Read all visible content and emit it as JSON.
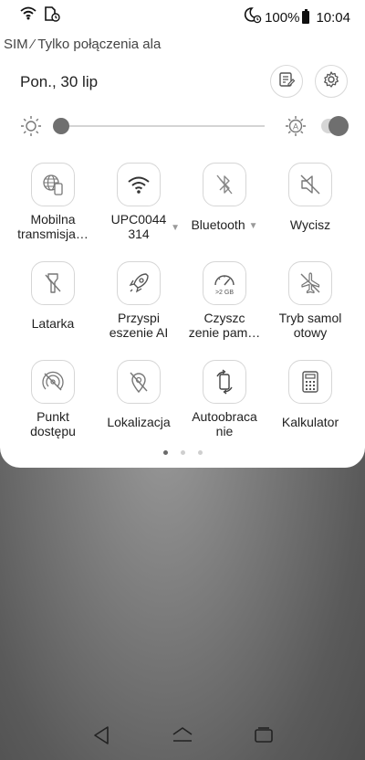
{
  "status_bar": {
    "battery": "100%",
    "time": "10:04",
    "icons": [
      "wifi-icon",
      "sim-alarm-icon",
      "moon-alarm-icon",
      "battery-icon"
    ]
  },
  "carrier_text": "SIM ⁄ Tylko połączenia ala",
  "date": "Pon., 30 lip",
  "header_buttons": [
    "edit-icon",
    "settings-gear-icon"
  ],
  "brightness": {
    "level": 0.0,
    "auto": true
  },
  "tiles": [
    {
      "line1": "Mobilna",
      "line2": "transmisja…",
      "icon": "globe-phone-icon"
    },
    {
      "line1": "UPC0044",
      "line2": "314",
      "icon": "wifi-icon",
      "dropdown": true
    },
    {
      "line1": "Bluetooth",
      "icon": "bluetooth-off-icon",
      "dropdown": true
    },
    {
      "line1": "Wycisz",
      "icon": "mute-icon"
    },
    {
      "line1": "Latarka",
      "icon": "flashlight-off-icon"
    },
    {
      "line1": "Przyspi",
      "line2": "eszenie AI",
      "icon": "rocket-icon"
    },
    {
      "line1": "Czyszc",
      "line2": "zenie pam…",
      "icon": "memory-cleaner-icon",
      "badge": ">2 GB"
    },
    {
      "line1": "Tryb samol",
      "line2": "otowy",
      "icon": "airplane-off-icon"
    },
    {
      "line1": "Punkt",
      "line2": "dostępu",
      "icon": "hotspot-off-icon"
    },
    {
      "line1": "Lokalizacja",
      "icon": "location-off-icon"
    },
    {
      "line1": "Autoobraca",
      "line2": "nie",
      "icon": "auto-rotate-icon"
    },
    {
      "line1": "Kalkulator",
      "icon": "calculator-icon"
    }
  ],
  "page_indicator": {
    "pages": 3,
    "current": 1
  },
  "nav_bar": [
    "back-icon",
    "home-icon",
    "recents-icon"
  ]
}
